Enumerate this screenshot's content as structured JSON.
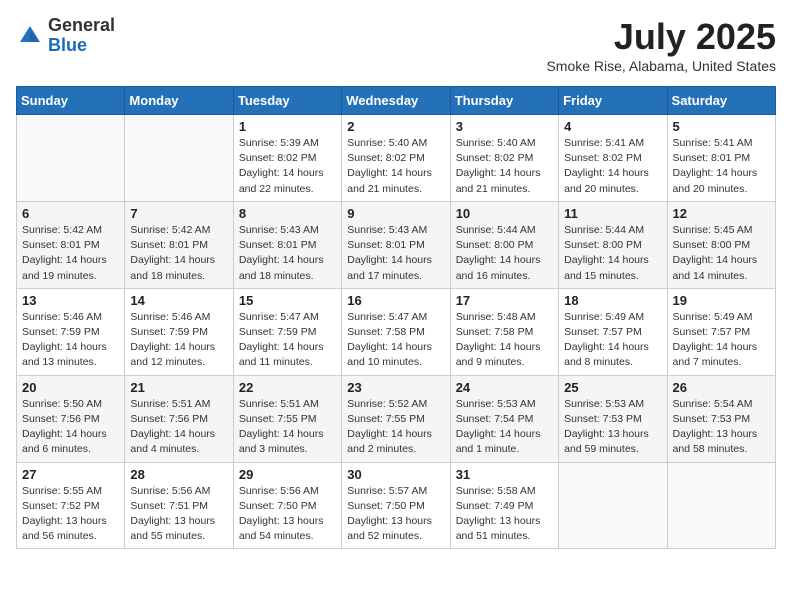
{
  "header": {
    "logo_general": "General",
    "logo_blue": "Blue",
    "month_title": "July 2025",
    "location": "Smoke Rise, Alabama, United States"
  },
  "days_of_week": [
    "Sunday",
    "Monday",
    "Tuesday",
    "Wednesday",
    "Thursday",
    "Friday",
    "Saturday"
  ],
  "weeks": [
    [
      {
        "day": "",
        "info": ""
      },
      {
        "day": "",
        "info": ""
      },
      {
        "day": "1",
        "info": "Sunrise: 5:39 AM\nSunset: 8:02 PM\nDaylight: 14 hours and 22 minutes."
      },
      {
        "day": "2",
        "info": "Sunrise: 5:40 AM\nSunset: 8:02 PM\nDaylight: 14 hours and 21 minutes."
      },
      {
        "day": "3",
        "info": "Sunrise: 5:40 AM\nSunset: 8:02 PM\nDaylight: 14 hours and 21 minutes."
      },
      {
        "day": "4",
        "info": "Sunrise: 5:41 AM\nSunset: 8:02 PM\nDaylight: 14 hours and 20 minutes."
      },
      {
        "day": "5",
        "info": "Sunrise: 5:41 AM\nSunset: 8:01 PM\nDaylight: 14 hours and 20 minutes."
      }
    ],
    [
      {
        "day": "6",
        "info": "Sunrise: 5:42 AM\nSunset: 8:01 PM\nDaylight: 14 hours and 19 minutes."
      },
      {
        "day": "7",
        "info": "Sunrise: 5:42 AM\nSunset: 8:01 PM\nDaylight: 14 hours and 18 minutes."
      },
      {
        "day": "8",
        "info": "Sunrise: 5:43 AM\nSunset: 8:01 PM\nDaylight: 14 hours and 18 minutes."
      },
      {
        "day": "9",
        "info": "Sunrise: 5:43 AM\nSunset: 8:01 PM\nDaylight: 14 hours and 17 minutes."
      },
      {
        "day": "10",
        "info": "Sunrise: 5:44 AM\nSunset: 8:00 PM\nDaylight: 14 hours and 16 minutes."
      },
      {
        "day": "11",
        "info": "Sunrise: 5:44 AM\nSunset: 8:00 PM\nDaylight: 14 hours and 15 minutes."
      },
      {
        "day": "12",
        "info": "Sunrise: 5:45 AM\nSunset: 8:00 PM\nDaylight: 14 hours and 14 minutes."
      }
    ],
    [
      {
        "day": "13",
        "info": "Sunrise: 5:46 AM\nSunset: 7:59 PM\nDaylight: 14 hours and 13 minutes."
      },
      {
        "day": "14",
        "info": "Sunrise: 5:46 AM\nSunset: 7:59 PM\nDaylight: 14 hours and 12 minutes."
      },
      {
        "day": "15",
        "info": "Sunrise: 5:47 AM\nSunset: 7:59 PM\nDaylight: 14 hours and 11 minutes."
      },
      {
        "day": "16",
        "info": "Sunrise: 5:47 AM\nSunset: 7:58 PM\nDaylight: 14 hours and 10 minutes."
      },
      {
        "day": "17",
        "info": "Sunrise: 5:48 AM\nSunset: 7:58 PM\nDaylight: 14 hours and 9 minutes."
      },
      {
        "day": "18",
        "info": "Sunrise: 5:49 AM\nSunset: 7:57 PM\nDaylight: 14 hours and 8 minutes."
      },
      {
        "day": "19",
        "info": "Sunrise: 5:49 AM\nSunset: 7:57 PM\nDaylight: 14 hours and 7 minutes."
      }
    ],
    [
      {
        "day": "20",
        "info": "Sunrise: 5:50 AM\nSunset: 7:56 PM\nDaylight: 14 hours and 6 minutes."
      },
      {
        "day": "21",
        "info": "Sunrise: 5:51 AM\nSunset: 7:56 PM\nDaylight: 14 hours and 4 minutes."
      },
      {
        "day": "22",
        "info": "Sunrise: 5:51 AM\nSunset: 7:55 PM\nDaylight: 14 hours and 3 minutes."
      },
      {
        "day": "23",
        "info": "Sunrise: 5:52 AM\nSunset: 7:55 PM\nDaylight: 14 hours and 2 minutes."
      },
      {
        "day": "24",
        "info": "Sunrise: 5:53 AM\nSunset: 7:54 PM\nDaylight: 14 hours and 1 minute."
      },
      {
        "day": "25",
        "info": "Sunrise: 5:53 AM\nSunset: 7:53 PM\nDaylight: 13 hours and 59 minutes."
      },
      {
        "day": "26",
        "info": "Sunrise: 5:54 AM\nSunset: 7:53 PM\nDaylight: 13 hours and 58 minutes."
      }
    ],
    [
      {
        "day": "27",
        "info": "Sunrise: 5:55 AM\nSunset: 7:52 PM\nDaylight: 13 hours and 56 minutes."
      },
      {
        "day": "28",
        "info": "Sunrise: 5:56 AM\nSunset: 7:51 PM\nDaylight: 13 hours and 55 minutes."
      },
      {
        "day": "29",
        "info": "Sunrise: 5:56 AM\nSunset: 7:50 PM\nDaylight: 13 hours and 54 minutes."
      },
      {
        "day": "30",
        "info": "Sunrise: 5:57 AM\nSunset: 7:50 PM\nDaylight: 13 hours and 52 minutes."
      },
      {
        "day": "31",
        "info": "Sunrise: 5:58 AM\nSunset: 7:49 PM\nDaylight: 13 hours and 51 minutes."
      },
      {
        "day": "",
        "info": ""
      },
      {
        "day": "",
        "info": ""
      }
    ]
  ]
}
